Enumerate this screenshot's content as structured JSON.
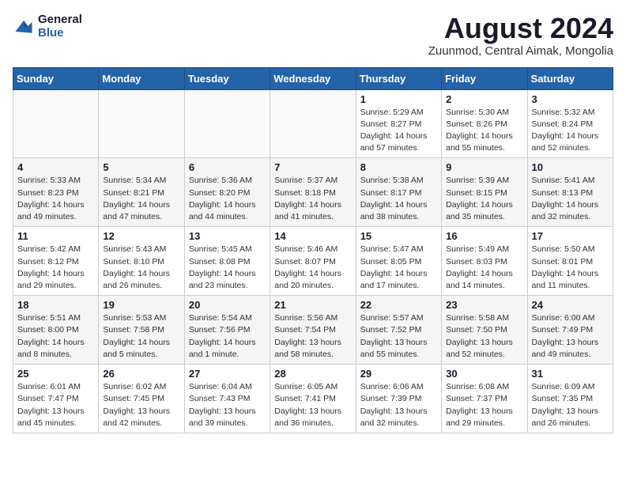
{
  "logo": {
    "line1": "General",
    "line2": "Blue"
  },
  "header": {
    "title": "August 2024",
    "location": "Zuunmod, Central Aimak, Mongolia"
  },
  "weekdays": [
    "Sunday",
    "Monday",
    "Tuesday",
    "Wednesday",
    "Thursday",
    "Friday",
    "Saturday"
  ],
  "weeks": [
    [
      {
        "day": "",
        "info": ""
      },
      {
        "day": "",
        "info": ""
      },
      {
        "day": "",
        "info": ""
      },
      {
        "day": "",
        "info": ""
      },
      {
        "day": "1",
        "info": "Sunrise: 5:29 AM\nSunset: 8:27 PM\nDaylight: 14 hours\nand 57 minutes."
      },
      {
        "day": "2",
        "info": "Sunrise: 5:30 AM\nSunset: 8:26 PM\nDaylight: 14 hours\nand 55 minutes."
      },
      {
        "day": "3",
        "info": "Sunrise: 5:32 AM\nSunset: 8:24 PM\nDaylight: 14 hours\nand 52 minutes."
      }
    ],
    [
      {
        "day": "4",
        "info": "Sunrise: 5:33 AM\nSunset: 8:23 PM\nDaylight: 14 hours\nand 49 minutes."
      },
      {
        "day": "5",
        "info": "Sunrise: 5:34 AM\nSunset: 8:21 PM\nDaylight: 14 hours\nand 47 minutes."
      },
      {
        "day": "6",
        "info": "Sunrise: 5:36 AM\nSunset: 8:20 PM\nDaylight: 14 hours\nand 44 minutes."
      },
      {
        "day": "7",
        "info": "Sunrise: 5:37 AM\nSunset: 8:18 PM\nDaylight: 14 hours\nand 41 minutes."
      },
      {
        "day": "8",
        "info": "Sunrise: 5:38 AM\nSunset: 8:17 PM\nDaylight: 14 hours\nand 38 minutes."
      },
      {
        "day": "9",
        "info": "Sunrise: 5:39 AM\nSunset: 8:15 PM\nDaylight: 14 hours\nand 35 minutes."
      },
      {
        "day": "10",
        "info": "Sunrise: 5:41 AM\nSunset: 8:13 PM\nDaylight: 14 hours\nand 32 minutes."
      }
    ],
    [
      {
        "day": "11",
        "info": "Sunrise: 5:42 AM\nSunset: 8:12 PM\nDaylight: 14 hours\nand 29 minutes."
      },
      {
        "day": "12",
        "info": "Sunrise: 5:43 AM\nSunset: 8:10 PM\nDaylight: 14 hours\nand 26 minutes."
      },
      {
        "day": "13",
        "info": "Sunrise: 5:45 AM\nSunset: 8:08 PM\nDaylight: 14 hours\nand 23 minutes."
      },
      {
        "day": "14",
        "info": "Sunrise: 5:46 AM\nSunset: 8:07 PM\nDaylight: 14 hours\nand 20 minutes."
      },
      {
        "day": "15",
        "info": "Sunrise: 5:47 AM\nSunset: 8:05 PM\nDaylight: 14 hours\nand 17 minutes."
      },
      {
        "day": "16",
        "info": "Sunrise: 5:49 AM\nSunset: 8:03 PM\nDaylight: 14 hours\nand 14 minutes."
      },
      {
        "day": "17",
        "info": "Sunrise: 5:50 AM\nSunset: 8:01 PM\nDaylight: 14 hours\nand 11 minutes."
      }
    ],
    [
      {
        "day": "18",
        "info": "Sunrise: 5:51 AM\nSunset: 8:00 PM\nDaylight: 14 hours\nand 8 minutes."
      },
      {
        "day": "19",
        "info": "Sunrise: 5:53 AM\nSunset: 7:58 PM\nDaylight: 14 hours\nand 5 minutes."
      },
      {
        "day": "20",
        "info": "Sunrise: 5:54 AM\nSunset: 7:56 PM\nDaylight: 14 hours\nand 1 minute."
      },
      {
        "day": "21",
        "info": "Sunrise: 5:56 AM\nSunset: 7:54 PM\nDaylight: 13 hours\nand 58 minutes."
      },
      {
        "day": "22",
        "info": "Sunrise: 5:57 AM\nSunset: 7:52 PM\nDaylight: 13 hours\nand 55 minutes."
      },
      {
        "day": "23",
        "info": "Sunrise: 5:58 AM\nSunset: 7:50 PM\nDaylight: 13 hours\nand 52 minutes."
      },
      {
        "day": "24",
        "info": "Sunrise: 6:00 AM\nSunset: 7:49 PM\nDaylight: 13 hours\nand 49 minutes."
      }
    ],
    [
      {
        "day": "25",
        "info": "Sunrise: 6:01 AM\nSunset: 7:47 PM\nDaylight: 13 hours\nand 45 minutes."
      },
      {
        "day": "26",
        "info": "Sunrise: 6:02 AM\nSunset: 7:45 PM\nDaylight: 13 hours\nand 42 minutes."
      },
      {
        "day": "27",
        "info": "Sunrise: 6:04 AM\nSunset: 7:43 PM\nDaylight: 13 hours\nand 39 minutes."
      },
      {
        "day": "28",
        "info": "Sunrise: 6:05 AM\nSunset: 7:41 PM\nDaylight: 13 hours\nand 36 minutes."
      },
      {
        "day": "29",
        "info": "Sunrise: 6:06 AM\nSunset: 7:39 PM\nDaylight: 13 hours\nand 32 minutes."
      },
      {
        "day": "30",
        "info": "Sunrise: 6:08 AM\nSunset: 7:37 PM\nDaylight: 13 hours\nand 29 minutes."
      },
      {
        "day": "31",
        "info": "Sunrise: 6:09 AM\nSunset: 7:35 PM\nDaylight: 13 hours\nand 26 minutes."
      }
    ]
  ]
}
